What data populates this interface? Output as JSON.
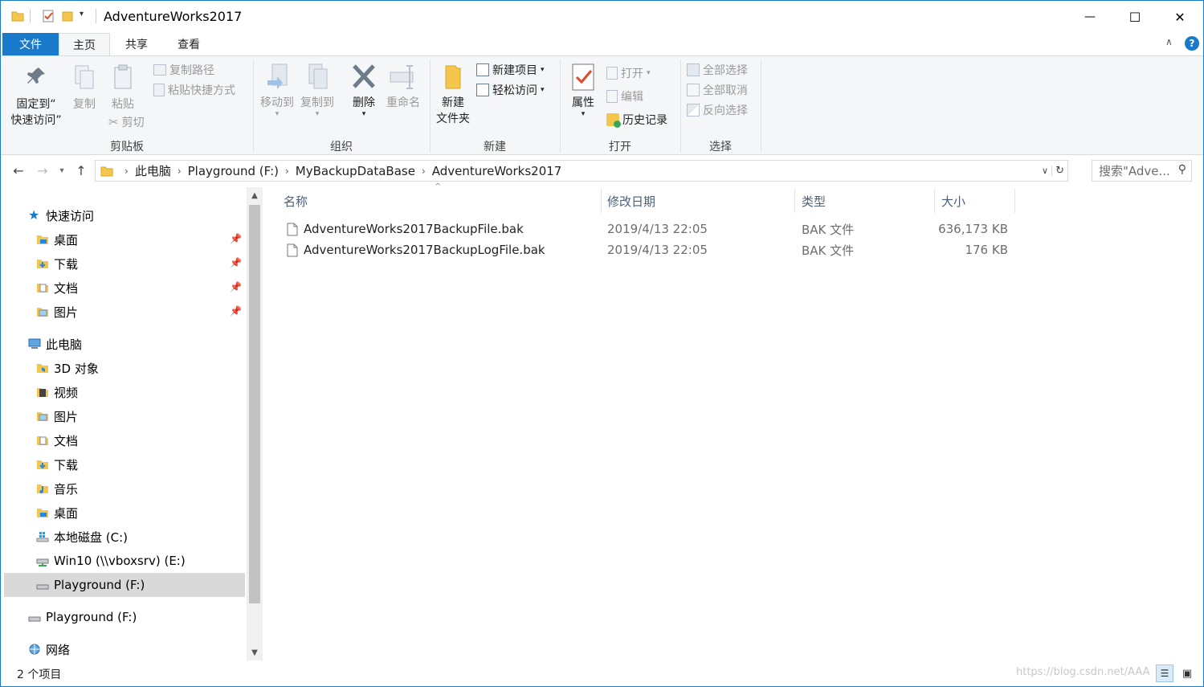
{
  "window": {
    "title": "AdventureWorks2017",
    "minimize_glyph": "—",
    "maximize_glyph": "☐",
    "close_glyph": "✕"
  },
  "tabs": {
    "file": "文件",
    "home": "主页",
    "share": "共享",
    "view": "查看"
  },
  "ribbon": {
    "clipboard": {
      "group_label": "剪贴板",
      "pin_quick_line1": "固定到“",
      "pin_quick_line2": "快速访问”",
      "copy": "复制",
      "paste": "粘贴",
      "copy_path": "复制路径",
      "paste_shortcut": "粘贴快捷方式",
      "cut": "剪切"
    },
    "organize": {
      "group_label": "组织",
      "move_to": "移动到",
      "copy_to": "复制到",
      "delete": "删除",
      "rename": "重命名"
    },
    "new": {
      "group_label": "新建",
      "new_folder_line1": "新建",
      "new_folder_line2": "文件夹",
      "new_item": "新建项目",
      "easy_access": "轻松访问"
    },
    "open": {
      "group_label": "打开",
      "properties": "属性",
      "open": "打开",
      "edit": "编辑",
      "history": "历史记录"
    },
    "select": {
      "group_label": "选择",
      "select_all": "全部选择",
      "select_none": "全部取消",
      "invert": "反向选择"
    }
  },
  "address": {
    "crumbs": [
      "此电脑",
      "Playground (F:)",
      "MyBackupDataBase",
      "AdventureWorks2017"
    ],
    "search_placeholder": "搜索\"Adve..."
  },
  "nav": {
    "quick_access": "快速访问",
    "quick_items": [
      "桌面",
      "下载",
      "文档",
      "图片"
    ],
    "this_pc": "此电脑",
    "pc_items": [
      "3D 对象",
      "视频",
      "图片",
      "文档",
      "下载",
      "音乐",
      "桌面",
      "本地磁盘 (C:)",
      "Win10 (\\\\vboxsrv) (E:)",
      "Playground (F:)"
    ],
    "playground": "Playground (F:)",
    "network": "网络"
  },
  "columns": {
    "name": "名称",
    "modified": "修改日期",
    "type": "类型",
    "size": "大小"
  },
  "files": [
    {
      "name": "AdventureWorks2017BackupFile.bak",
      "modified": "2019/4/13 22:05",
      "type": "BAK 文件",
      "size": "636,173 KB"
    },
    {
      "name": "AdventureWorks2017BackupLogFile.bak",
      "modified": "2019/4/13 22:05",
      "type": "BAK 文件",
      "size": "176 KB"
    }
  ],
  "status": {
    "count": "2 个项目",
    "watermark": "https://blog.csdn.net/AAA"
  },
  "colors": {
    "accent": "#1979ca",
    "ribbon_bg": "#f5f6f7",
    "selected_nav": "#d9d9d9",
    "header_text": "#4c607a",
    "folder": "#f4c64d"
  }
}
